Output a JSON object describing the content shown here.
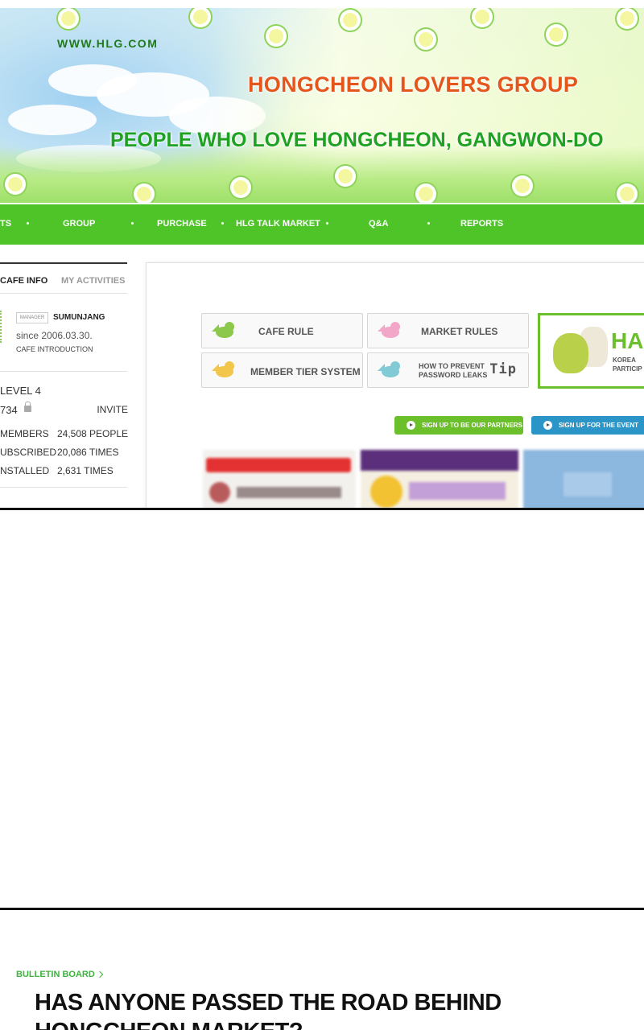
{
  "banner": {
    "url": "WWW.HLG.COM",
    "title": "HONGCHEON LOVERS GROUP",
    "subtitle": "PEOPLE WHO LOVE HONGCHEON, GANGWON-DO"
  },
  "nav": {
    "items": [
      "TS",
      "GROUP",
      "PURCHASE",
      "HLG TALK MARKET",
      "Q&A",
      "REPORTS"
    ]
  },
  "sidebar": {
    "tab_info": "CAFE INFO",
    "tab_activities": "MY ACTIVITIES",
    "manager_badge": "MANAGER",
    "manager_name": "SUMUNJANG",
    "since": "since 2006.03.30.",
    "intro": "CAFE INTRODUCTION",
    "level": "LEVEL 4",
    "member_no": "734",
    "invite": "INVITE",
    "stats": [
      {
        "label": "MEMBERS",
        "value": "24,508 PEOPLE"
      },
      {
        "label": "UBSCRIBED",
        "value": "20,086 TIMES"
      },
      {
        "label": "NSTALLED",
        "value": "2,631 TIMES"
      }
    ]
  },
  "main": {
    "rule_buttons": {
      "cafe_rule": "CAFE RULE",
      "market_rules": "MARKET RULES",
      "member_tier": "MEMBER TIER SYSTEM",
      "prevent_line1": "HOW TO PREVENT",
      "prevent_line2": "PASSWORD LEAKS",
      "tip": "Tip"
    },
    "promo": {
      "big": "HA",
      "line1": "KOREA",
      "line2": "PARTICIP"
    },
    "partners_button": "SIGN UP TO BE OUR PARTNERS",
    "event_button": "SIGN UP FOR THE EVENT"
  },
  "article": {
    "breadcrumb": "BULLETIN BOARD",
    "headline": "HAS ANYONE PASSED THE ROAD BEHIND HONGCHEON MARKET?"
  },
  "colors": {
    "nav_green": "#4ec429",
    "title_orange": "#e5561c",
    "subtitle_green": "#1fa122",
    "crumb_green": "#3db33d"
  }
}
